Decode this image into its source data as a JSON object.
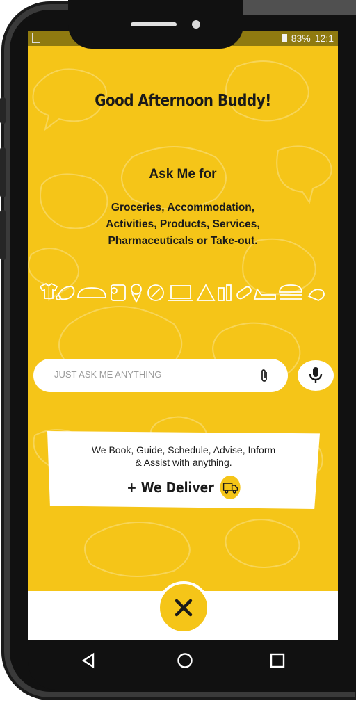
{
  "status": {
    "battery": "83%",
    "time": "12:1"
  },
  "greeting": "Good Afternoon Buddy!",
  "ask": {
    "title": "Ask Me for",
    "categories_line1": "Groceries, Accommodation,",
    "categories_line2": "Activities, Products, Services,",
    "categories_line3": "Pharmaceuticals or Take-out."
  },
  "category_icons": [
    "shirt-icon",
    "meat-icon",
    "bread-icon",
    "toilet-paper-icon",
    "vegetables-icon",
    "discount-icon",
    "laptop-icon",
    "pizza-icon",
    "drinks-icon",
    "pills-icon",
    "shoe-icon",
    "burger-icon"
  ],
  "search": {
    "placeholder": "JUST ASK ME ANYTHING"
  },
  "card": {
    "line1": "We Book, Guide, Schedule, Advise, Inform",
    "line2": "& Assist with anything.",
    "deliver": "+ We Deliver"
  },
  "colors": {
    "primary": "#f5c518",
    "dark": "#1a1a1a",
    "white": "#ffffff"
  },
  "navbar": [
    "back-icon",
    "home-icon",
    "recents-icon"
  ]
}
